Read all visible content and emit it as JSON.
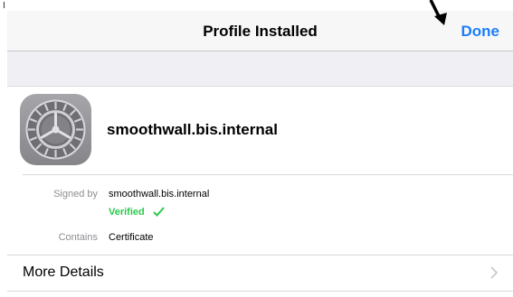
{
  "nav": {
    "title": "Profile Installed",
    "done_label": "Done",
    "accent_color": "#1b7ef6"
  },
  "profile": {
    "icon": "settings-gear-icon",
    "name": "smoothwall.bis.internal"
  },
  "details": {
    "signed_by_label": "Signed by",
    "signed_by_value": "smoothwall.bis.internal",
    "verified_text": "Verified",
    "verified_color": "#2ec84d",
    "contains_label": "Contains",
    "contains_value": "Certificate"
  },
  "more_details": {
    "label": "More Details",
    "icon": "chevron-right-icon"
  },
  "annotation": {
    "icon": "black-arrow-pointing-down-icon"
  }
}
